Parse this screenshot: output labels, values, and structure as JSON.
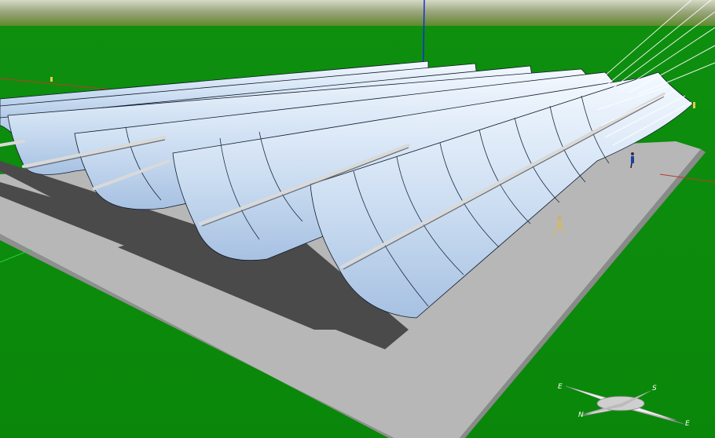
{
  "viewport": {
    "sky_colors": [
      "#c7cdb6",
      "#9aa37c",
      "#6f8a3e"
    ],
    "ground_color": "#0b8c0b",
    "platform_color": "#bdbdbd",
    "shadow_color": "#4a4a4a",
    "mirror_colors": [
      "#f3f8ff",
      "#c8daf0",
      "#9db8dc"
    ],
    "axis_colors": {
      "x": "#c0392b",
      "y": "#1b2bd6",
      "z": "#2ecc40"
    }
  },
  "scene": {
    "collector_row_count": 7,
    "sun_ray_color": "#ffffff",
    "people": [
      "person-near-corner",
      "person-on-walkway",
      "person-far-right",
      "person-far-left"
    ]
  },
  "compass": {
    "labels": {
      "west": "E",
      "south": "S",
      "north": "N",
      "east": "E"
    },
    "needle_color": "#d8d8d8"
  }
}
